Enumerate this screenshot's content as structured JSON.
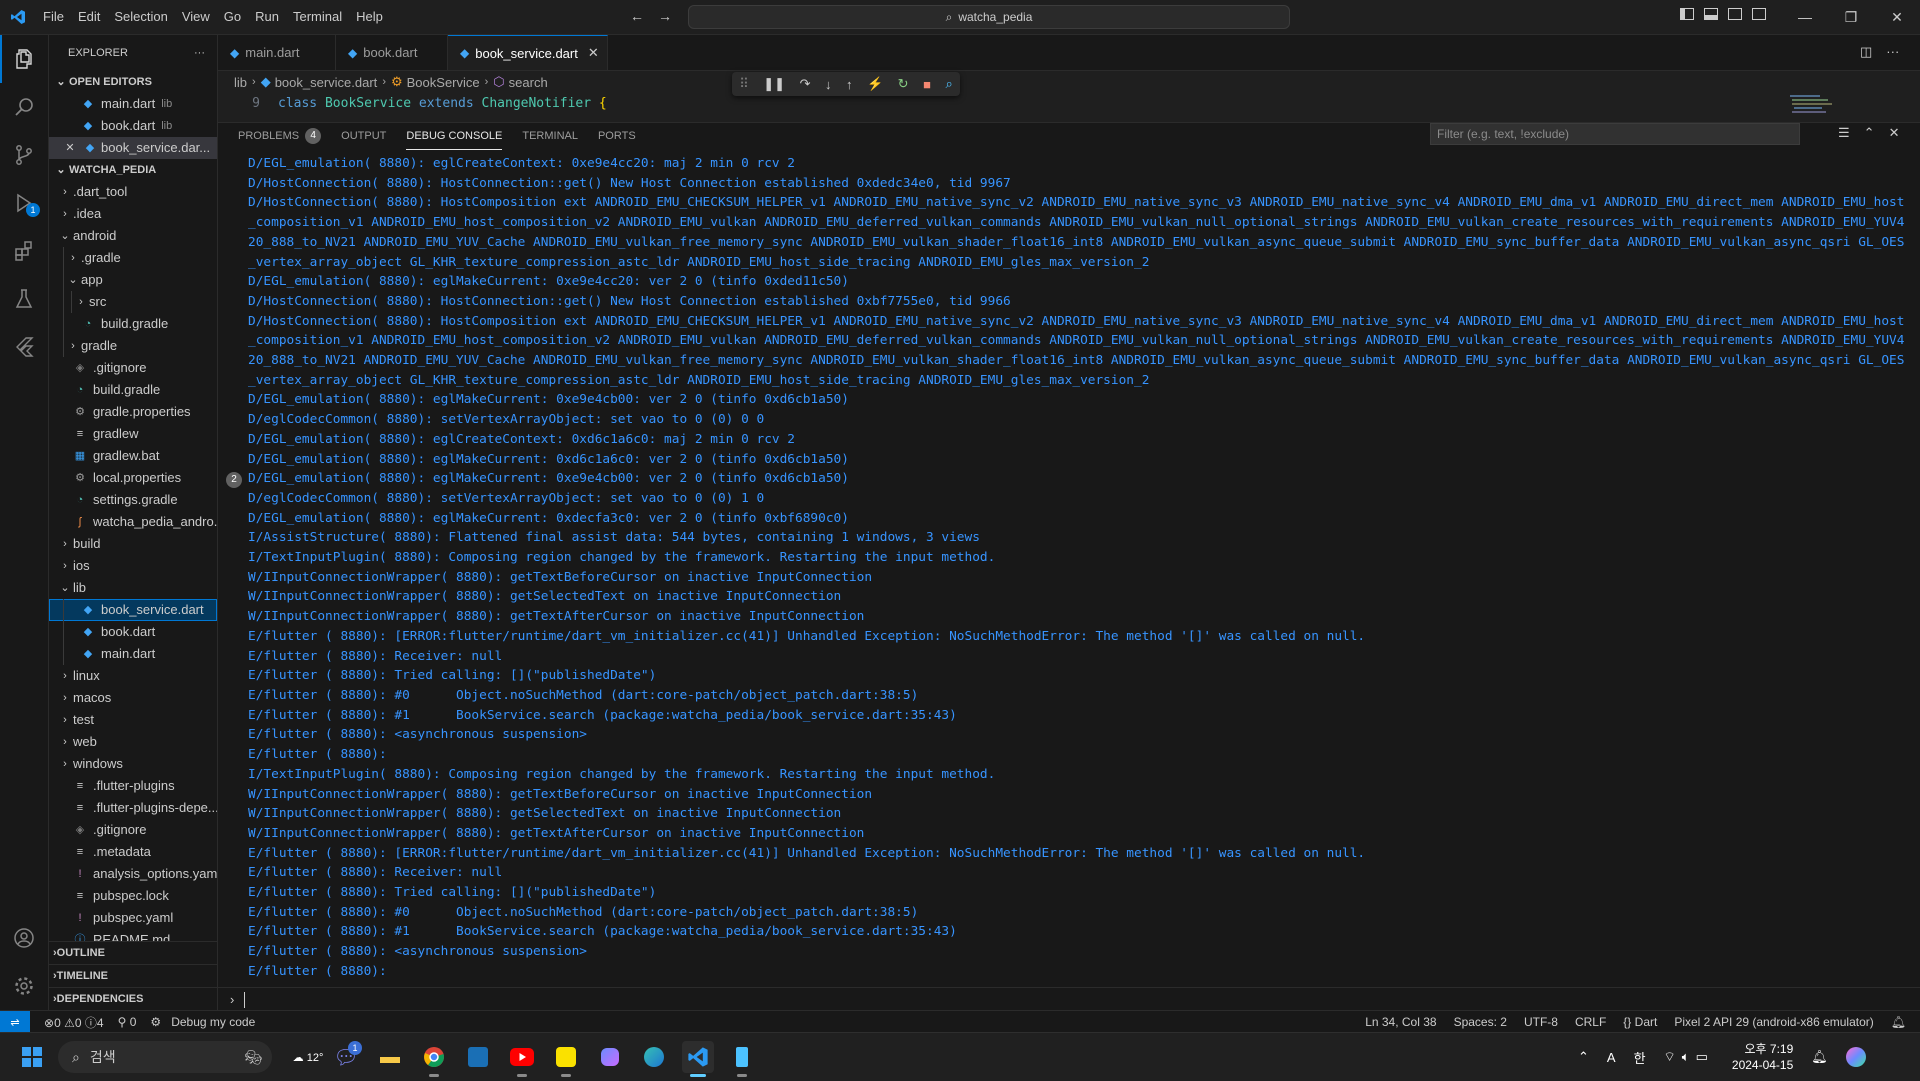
{
  "titlebar": {
    "menus": [
      "File",
      "Edit",
      "Selection",
      "View",
      "Go",
      "Run",
      "Terminal",
      "Help"
    ],
    "search": "watcha_pedia"
  },
  "activity": {
    "debug_badge": "1"
  },
  "sidebar": {
    "title": "EXPLORER",
    "open_editors_label": "OPEN EDITORS",
    "open_editors": [
      {
        "name": "main.dart",
        "dir": "lib"
      },
      {
        "name": "book.dart",
        "dir": "lib"
      },
      {
        "name": "book_service.dar..."
      }
    ],
    "project_label": "WATCHA_PEDIA",
    "tree": [
      ".dart_tool",
      ".idea",
      "android",
      ".gradle",
      "app",
      "src",
      "build.gradle",
      "gradle",
      ".gitignore",
      "build.gradle",
      "gradle.properties",
      "gradlew",
      "gradlew.bat",
      "local.properties",
      "settings.gradle",
      "watcha_pedia_andro...",
      "build",
      "ios",
      "lib",
      "book_service.dart",
      "book.dart",
      "main.dart",
      "linux",
      "macos",
      "test",
      "web",
      "windows",
      ".flutter-plugins",
      ".flutter-plugins-depe...",
      ".gitignore",
      ".metadata",
      "analysis_options.yaml",
      "pubspec.lock",
      "pubspec.yaml",
      "README.md"
    ],
    "bottom_sections": [
      "OUTLINE",
      "TIMELINE",
      "DEPENDENCIES"
    ]
  },
  "editor": {
    "tabs": [
      "main.dart",
      "book.dart",
      "book_service.dart"
    ],
    "breadcrumb": [
      "lib",
      "book_service.dart",
      "BookService",
      "search"
    ],
    "line_number": "9",
    "code": {
      "kw1": "class",
      "cls": "BookService",
      "kw2": "extends",
      "parent": "ChangeNotifier",
      "brace": "{"
    }
  },
  "panel": {
    "tabs": [
      "PROBLEMS",
      "OUTPUT",
      "DEBUG CONSOLE",
      "TERMINAL",
      "PORTS"
    ],
    "problems_count": "4",
    "filter_placeholder": "Filter (e.g. text, !exclude)",
    "repeat_count": "2",
    "lines": [
      "D/EGL_emulation( 8880): eglCreateContext: 0xe9e4cc20: maj 2 min 0 rcv 2",
      "D/HostConnection( 8880): HostConnection::get() New Host Connection established 0xdedc34e0, tid 9967",
      "D/HostConnection( 8880): HostComposition ext ANDROID_EMU_CHECKSUM_HELPER_v1 ANDROID_EMU_native_sync_v2 ANDROID_EMU_native_sync_v3 ANDROID_EMU_native_sync_v4 ANDROID_EMU_dma_v1 ANDROID_EMU_direct_mem ANDROID_EMU_host",
      "_composition_v1 ANDROID_EMU_host_composition_v2 ANDROID_EMU_vulkan ANDROID_EMU_deferred_vulkan_commands ANDROID_EMU_vulkan_null_optional_strings ANDROID_EMU_vulkan_create_resources_with_requirements ANDROID_EMU_YUV4",
      "20_888_to_NV21 ANDROID_EMU_YUV_Cache ANDROID_EMU_vulkan_free_memory_sync ANDROID_EMU_vulkan_shader_float16_int8 ANDROID_EMU_vulkan_async_queue_submit ANDROID_EMU_sync_buffer_data ANDROID_EMU_vulkan_async_qsri GL_OES",
      "_vertex_array_object GL_KHR_texture_compression_astc_ldr ANDROID_EMU_host_side_tracing ANDROID_EMU_gles_max_version_2",
      "D/EGL_emulation( 8880): eglMakeCurrent: 0xe9e4cc20: ver 2 0 (tinfo 0xded11c50)",
      "D/HostConnection( 8880): HostConnection::get() New Host Connection established 0xbf7755e0, tid 9966",
      "D/HostConnection( 8880): HostComposition ext ANDROID_EMU_CHECKSUM_HELPER_v1 ANDROID_EMU_native_sync_v2 ANDROID_EMU_native_sync_v3 ANDROID_EMU_native_sync_v4 ANDROID_EMU_dma_v1 ANDROID_EMU_direct_mem ANDROID_EMU_host",
      "_composition_v1 ANDROID_EMU_host_composition_v2 ANDROID_EMU_vulkan ANDROID_EMU_deferred_vulkan_commands ANDROID_EMU_vulkan_null_optional_strings ANDROID_EMU_vulkan_create_resources_with_requirements ANDROID_EMU_YUV4",
      "20_888_to_NV21 ANDROID_EMU_YUV_Cache ANDROID_EMU_vulkan_free_memory_sync ANDROID_EMU_vulkan_shader_float16_int8 ANDROID_EMU_vulkan_async_queue_submit ANDROID_EMU_sync_buffer_data ANDROID_EMU_vulkan_async_qsri GL_OES",
      "_vertex_array_object GL_KHR_texture_compression_astc_ldr ANDROID_EMU_host_side_tracing ANDROID_EMU_gles_max_version_2",
      "D/EGL_emulation( 8880): eglMakeCurrent: 0xe9e4cb00: ver 2 0 (tinfo 0xd6cb1a50)",
      "D/eglCodecCommon( 8880): setVertexArrayObject: set vao to 0 (0) 0 0",
      "D/EGL_emulation( 8880): eglCreateContext: 0xd6c1a6c0: maj 2 min 0 rcv 2",
      "D/EGL_emulation( 8880): eglMakeCurrent: 0xd6c1a6c0: ver 2 0 (tinfo 0xd6cb1a50)",
      "D/EGL_emulation( 8880): eglMakeCurrent: 0xe9e4cb00: ver 2 0 (tinfo 0xd6cb1a50)",
      "D/eglCodecCommon( 8880): setVertexArrayObject: set vao to 0 (0) 1 0",
      "D/EGL_emulation( 8880): eglMakeCurrent: 0xdecfa3c0: ver 2 0 (tinfo 0xbf6890c0)",
      "I/AssistStructure( 8880): Flattened final assist data: 544 bytes, containing 1 windows, 3 views",
      "I/TextInputPlugin( 8880): Composing region changed by the framework. Restarting the input method.",
      "W/IInputConnectionWrapper( 8880): getTextBeforeCursor on inactive InputConnection",
      "W/IInputConnectionWrapper( 8880): getSelectedText on inactive InputConnection",
      "W/IInputConnectionWrapper( 8880): getTextAfterCursor on inactive InputConnection",
      "E/flutter ( 8880): [ERROR:flutter/runtime/dart_vm_initializer.cc(41)] Unhandled Exception: NoSuchMethodError: The method '[]' was called on null.",
      "E/flutter ( 8880): Receiver: null",
      "E/flutter ( 8880): Tried calling: [](\"publishedDate\")",
      "E/flutter ( 8880): #0      Object.noSuchMethod (dart:core-patch/object_patch.dart:38:5)",
      "E/flutter ( 8880): #1      BookService.search (package:watcha_pedia/book_service.dart:35:43)",
      "E/flutter ( 8880): <asynchronous suspension>",
      "E/flutter ( 8880): ",
      "I/TextInputPlugin( 8880): Composing region changed by the framework. Restarting the input method.",
      "W/IInputConnectionWrapper( 8880): getTextBeforeCursor on inactive InputConnection",
      "W/IInputConnectionWrapper( 8880): getSelectedText on inactive InputConnection",
      "W/IInputConnectionWrapper( 8880): getTextAfterCursor on inactive InputConnection",
      "E/flutter ( 8880): [ERROR:flutter/runtime/dart_vm_initializer.cc(41)] Unhandled Exception: NoSuchMethodError: The method '[]' was called on null.",
      "E/flutter ( 8880): Receiver: null",
      "E/flutter ( 8880): Tried calling: [](\"publishedDate\")",
      "E/flutter ( 8880): #0      Object.noSuchMethod (dart:core-patch/object_patch.dart:38:5)",
      "E/flutter ( 8880): #1      BookService.search (package:watcha_pedia/book_service.dart:35:43)",
      "E/flutter ( 8880): <asynchronous suspension>",
      "E/flutter ( 8880): "
    ]
  },
  "statusbar": {
    "errors": "0",
    "warnings": "0",
    "info": "4",
    "ports": "0",
    "debug_label": "Debug my code",
    "position": "Ln 34, Col 38",
    "spaces": "Spaces: 2",
    "encoding": "UTF-8",
    "eol": "CRLF",
    "language": "Dart",
    "device": "Pixel 2 API 29 (android-x86 emulator)"
  },
  "taskbar": {
    "search_placeholder": "검색",
    "weather": "12°",
    "chat_badge": "1",
    "time": "오후 7:19",
    "date": "2024-04-15",
    "ime_a": "A",
    "ime_han": "한"
  },
  "colors": {
    "accent": "#0078d4",
    "console_text": "#3794ff",
    "dart": "#42a5f5"
  }
}
